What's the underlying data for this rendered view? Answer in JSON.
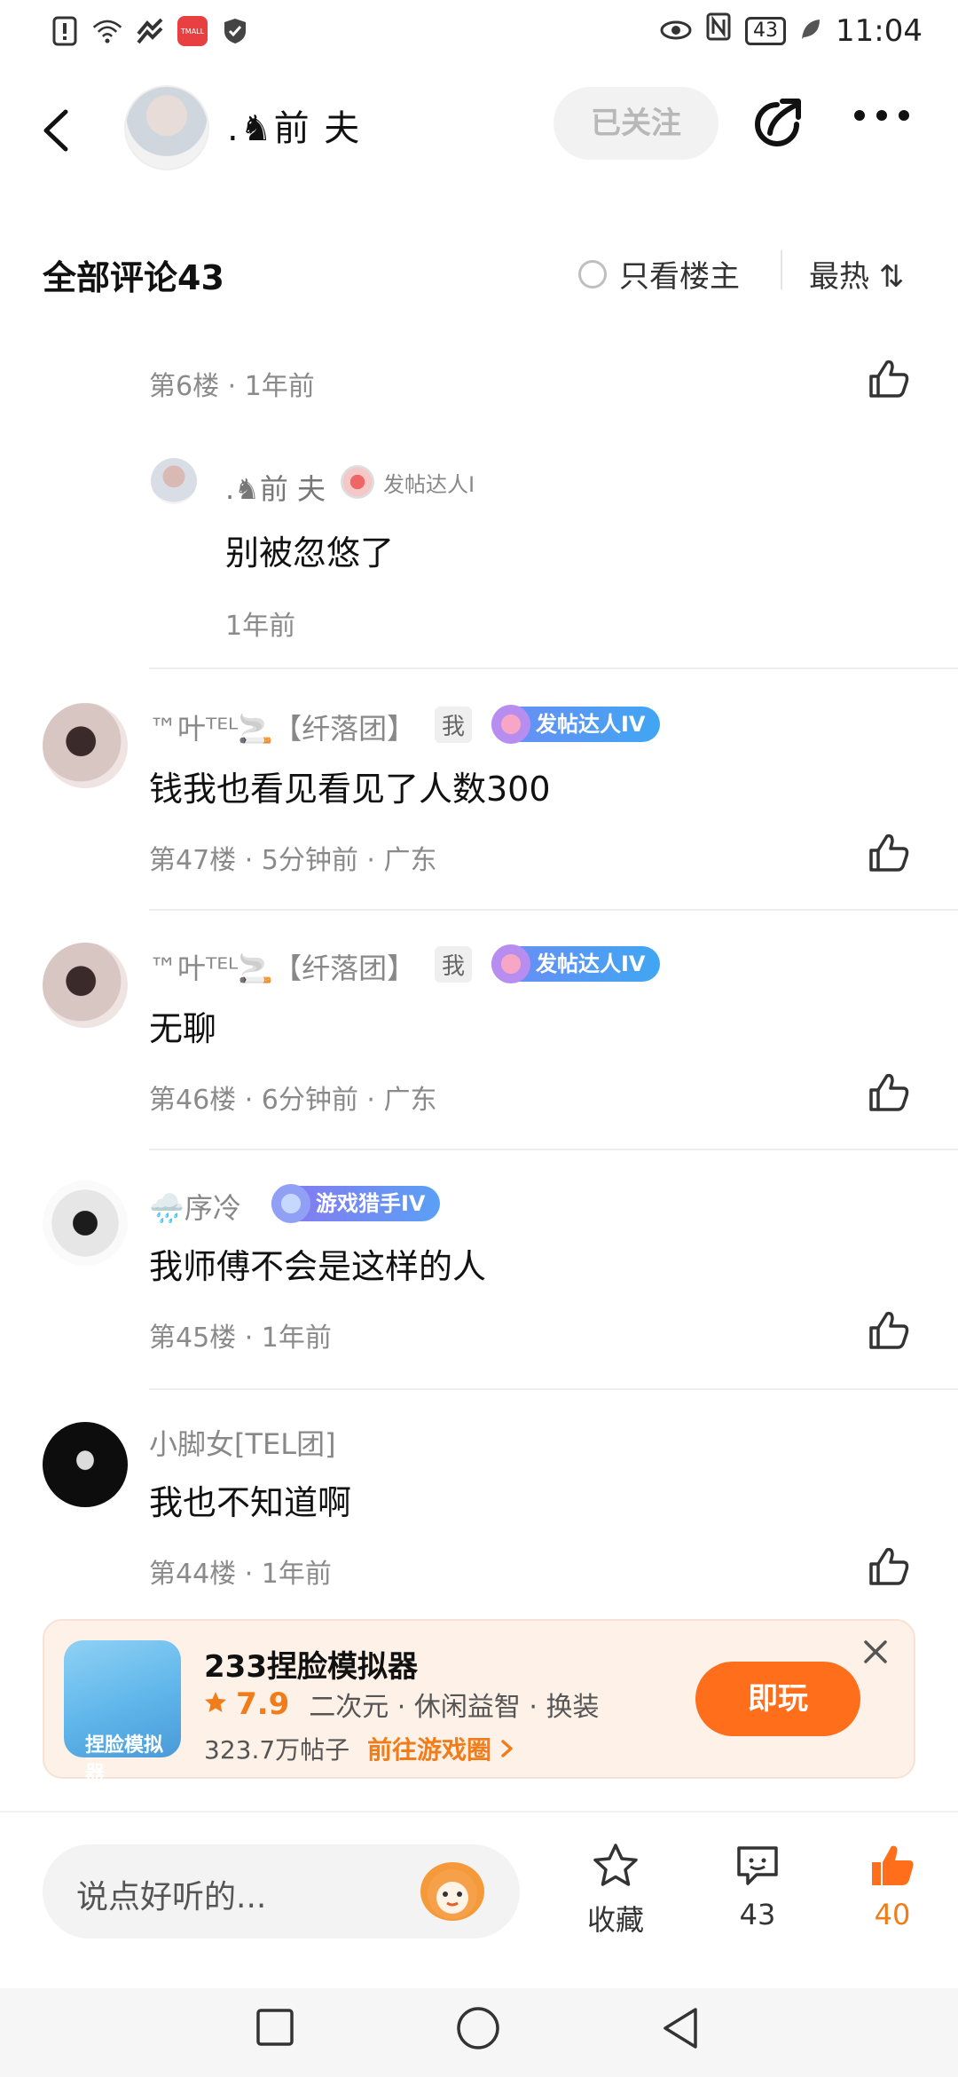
{
  "status_bar": {
    "time": "11:04",
    "battery": "43",
    "app_badge": "TMALL"
  },
  "header": {
    "username": ".♞前 夫",
    "follow_label": "已关注"
  },
  "comments_header": {
    "title": "全部评论43",
    "only_owner": "只看楼主",
    "sort": "最热 ⇅"
  },
  "floor6": {
    "meta": "第6楼 · 1年前",
    "reply": {
      "name": ".♞前 夫",
      "badge": "发帖达人I",
      "text": "别被忽悠了",
      "time": "1年前"
    }
  },
  "comments": [
    {
      "name": "™叶ᵀᴱᴸ🚬【纤落团】",
      "me_tag": "我",
      "badge": "发帖达人IV",
      "text": "钱我也看见看见了人数300",
      "meta": "第47楼 · 5分钟前 · 广东"
    },
    {
      "name": "™叶ᵀᴱᴸ🚬【纤落团】",
      "me_tag": "我",
      "badge": "发帖达人IV",
      "text": "无聊",
      "meta": "第46楼 · 6分钟前 · 广东"
    },
    {
      "name": "🌧️序冷",
      "badge": "游戏猎手IV",
      "text": "我师傅不会是这样的人",
      "meta": "第45楼 · 1年前"
    },
    {
      "name": "小脚女[TEL团]",
      "text": "我也不知道啊",
      "meta": "第44楼 · 1年前"
    }
  ],
  "ad": {
    "image_label": "捏脸模拟器",
    "title": "233捏脸模拟器",
    "score": "7.9",
    "tags": "二次元 · 休闲益智 · 换装",
    "posts": "323.7万帖子",
    "go_label": "前往游戏圈",
    "play_label": "即玩"
  },
  "bottom_bar": {
    "input_placeholder": "说点好听的...",
    "favorite_label": "收藏",
    "comment_count": "43",
    "like_count": "40"
  },
  "colors": {
    "accent": "#ff6e1a",
    "badge_blue": "#4a8ff0",
    "badge_purple": "#6f7cf0"
  }
}
